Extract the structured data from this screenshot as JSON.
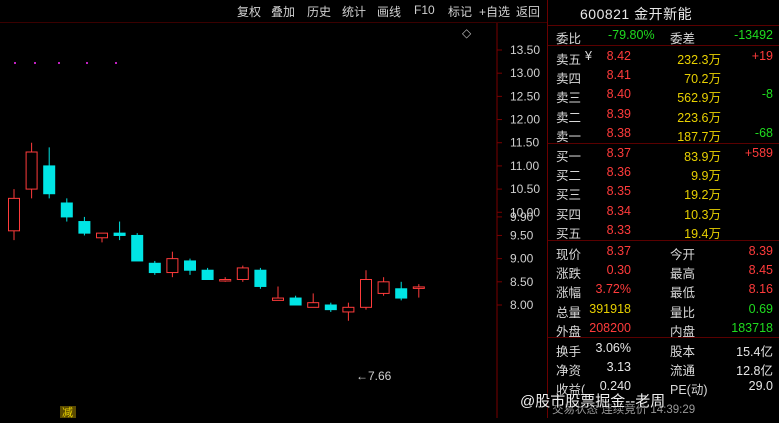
{
  "toolbar": {
    "items": [
      "复权",
      "叠加",
      "历史",
      "统计",
      "画线",
      "F10",
      "标记",
      "+自选",
      "返回"
    ]
  },
  "chart": {
    "price_axis": [
      "13.50",
      "13.00",
      "12.50",
      "12.00",
      "11.50",
      "11.00",
      "10.50",
      "10.00",
      "9.90",
      "9.50",
      "9.00",
      "8.50",
      "8.00"
    ],
    "low_marker": "←7.66",
    "tag_left": "减",
    "diamond": "◇",
    "colors": {
      "up": "#ff3b3b",
      "down": "#00e5e5",
      "bg": "#000000"
    }
  },
  "chart_data": {
    "type": "candlestick",
    "ylim": [
      7.5,
      13.7
    ],
    "candles": [
      {
        "o": 9.6,
        "h": 10.5,
        "l": 9.4,
        "c": 10.3
      },
      {
        "o": 10.5,
        "h": 11.5,
        "l": 10.3,
        "c": 11.3
      },
      {
        "o": 11.0,
        "h": 11.4,
        "l": 10.3,
        "c": 10.4
      },
      {
        "o": 10.2,
        "h": 10.3,
        "l": 9.8,
        "c": 9.9
      },
      {
        "o": 9.8,
        "h": 9.9,
        "l": 9.5,
        "c": 9.55
      },
      {
        "o": 9.45,
        "h": 9.55,
        "l": 9.35,
        "c": 9.55
      },
      {
        "o": 9.55,
        "h": 9.8,
        "l": 9.4,
        "c": 9.5
      },
      {
        "o": 9.5,
        "h": 9.55,
        "l": 8.95,
        "c": 8.95
      },
      {
        "o": 8.9,
        "h": 8.95,
        "l": 8.65,
        "c": 8.7
      },
      {
        "o": 8.7,
        "h": 9.15,
        "l": 8.6,
        "c": 9.0
      },
      {
        "o": 8.95,
        "h": 9.0,
        "l": 8.65,
        "c": 8.75
      },
      {
        "o": 8.75,
        "h": 8.8,
        "l": 8.55,
        "c": 8.55
      },
      {
        "o": 8.55,
        "h": 8.6,
        "l": 8.5,
        "c": 8.55
      },
      {
        "o": 8.55,
        "h": 8.85,
        "l": 8.5,
        "c": 8.8
      },
      {
        "o": 8.75,
        "h": 8.8,
        "l": 8.35,
        "c": 8.4
      },
      {
        "o": 8.1,
        "h": 8.4,
        "l": 8.1,
        "c": 8.15
      },
      {
        "o": 8.15,
        "h": 8.2,
        "l": 8.0,
        "c": 8.0
      },
      {
        "o": 7.95,
        "h": 8.25,
        "l": 7.95,
        "c": 8.05
      },
      {
        "o": 8.0,
        "h": 8.05,
        "l": 7.85,
        "c": 7.9
      },
      {
        "o": 7.85,
        "h": 8.05,
        "l": 7.66,
        "c": 7.95
      },
      {
        "o": 7.95,
        "h": 8.75,
        "l": 7.9,
        "c": 8.55
      },
      {
        "o": 8.25,
        "h": 8.6,
        "l": 8.2,
        "c": 8.5
      },
      {
        "o": 8.35,
        "h": 8.5,
        "l": 8.1,
        "c": 8.15
      },
      {
        "o": 8.37,
        "h": 8.45,
        "l": 8.16,
        "c": 8.39
      }
    ]
  },
  "quote": {
    "title": "600821 金开新能",
    "weibi_label": "委比",
    "weibi_value": "-79.80%",
    "weicha_label": "委差",
    "weicha_value": "-13492",
    "asks": [
      {
        "label": "卖五",
        "mark": "¥",
        "price": "8.42",
        "vol": "232.3万",
        "chg": "+19"
      },
      {
        "label": "卖四",
        "mark": "",
        "price": "8.41",
        "vol": "70.2万",
        "chg": ""
      },
      {
        "label": "卖三",
        "mark": "",
        "price": "8.40",
        "vol": "562.9万",
        "chg": "-8"
      },
      {
        "label": "卖二",
        "mark": "",
        "price": "8.39",
        "vol": "223.6万",
        "chg": ""
      },
      {
        "label": "卖一",
        "mark": "",
        "price": "8.38",
        "vol": "187.7万",
        "chg": "-68"
      }
    ],
    "bids": [
      {
        "label": "买一",
        "price": "8.37",
        "vol": "83.9万",
        "chg": "+589"
      },
      {
        "label": "买二",
        "price": "8.36",
        "vol": "9.9万",
        "chg": ""
      },
      {
        "label": "买三",
        "price": "8.35",
        "vol": "19.2万",
        "chg": ""
      },
      {
        "label": "买四",
        "price": "8.34",
        "vol": "10.3万",
        "chg": ""
      },
      {
        "label": "买五",
        "price": "8.33",
        "vol": "19.4万",
        "chg": ""
      }
    ],
    "stats": [
      {
        "l1": "现价",
        "v1": "8.37",
        "c1": "red",
        "l2": "今开",
        "v2": "8.39",
        "c2": "red"
      },
      {
        "l1": "涨跌",
        "v1": "0.30",
        "c1": "red",
        "l2": "最高",
        "v2": "8.45",
        "c2": "red"
      },
      {
        "l1": "涨幅",
        "v1": "3.72%",
        "c1": "red",
        "l2": "最低",
        "v2": "8.16",
        "c2": "red"
      },
      {
        "l1": "总量",
        "v1": "391918",
        "c1": "yellow",
        "l2": "量比",
        "v2": "0.69",
        "c2": "green"
      },
      {
        "l1": "外盘",
        "v1": "208200",
        "c1": "red",
        "l2": "内盘",
        "v2": "183718",
        "c2": "green"
      }
    ],
    "fundamentals": [
      {
        "l1": "换手",
        "v1": "3.06%",
        "l2": "股本",
        "v2": "15.4亿"
      },
      {
        "l1": "净资",
        "v1": "3.13",
        "l2": "流通",
        "v2": "12.8亿"
      },
      {
        "l1": "收益(",
        "v1": "0.240",
        "l2": "PE(动)",
        "v2": "29.0"
      }
    ],
    "status": "交易状态 连续竞价 14:39:29"
  },
  "watermark": "@股市股票掘金--老周"
}
